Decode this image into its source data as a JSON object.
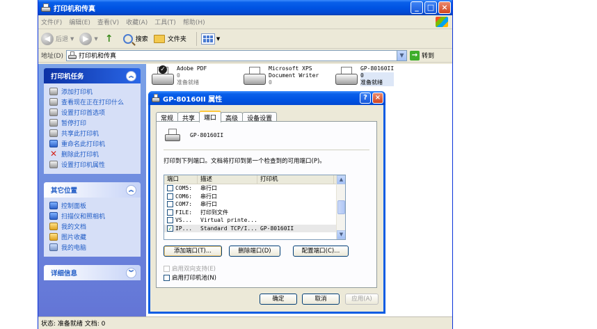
{
  "window": {
    "title": "打印机和传真",
    "menu": [
      "文件(F)",
      "编辑(E)",
      "查看(V)",
      "收藏(A)",
      "工具(T)",
      "帮助(H)"
    ],
    "toolbar": {
      "back": "后退",
      "search": "搜索",
      "folders": "文件夹"
    },
    "address": {
      "label": "地址(D)",
      "value": "打印机和传真",
      "go": "转到"
    },
    "status": "状态: 准备就绪 文档: 0"
  },
  "sidebar": {
    "printer_tasks": {
      "title": "打印机任务",
      "items": [
        "添加打印机",
        "查看现在正在打印什么",
        "设置打印首选项",
        "暂停打印",
        "共享此打印机",
        "重命名此打印机",
        "删除此打印机",
        "设置打印机属性"
      ]
    },
    "other_places": {
      "title": "其它位置",
      "items": [
        "控制面板",
        "扫描仪和照相机",
        "我的文档",
        "图片收藏",
        "我的电脑"
      ]
    },
    "details": {
      "title": "详细信息"
    }
  },
  "printers": [
    {
      "name": "Adobe PDF",
      "docs": "0",
      "status": "准备就绪"
    },
    {
      "name": "Microsoft XPS",
      "name2": "Document Writer",
      "docs": "0"
    },
    {
      "name": "GP-80160II",
      "docs": "0",
      "status": "准备就绪"
    }
  ],
  "dialog": {
    "title": "GP-80160II 属性",
    "tabs": [
      "常规",
      "共享",
      "端口",
      "高级",
      "设备设置"
    ],
    "active_tab": "端口",
    "device_name": "GP-80160II",
    "instruction": "打印到下列端口。文档将打印到第一个检查到的可用端口(P)。",
    "columns": [
      "端口",
      "描述",
      "打印机"
    ],
    "ports": [
      {
        "port": "COM5:",
        "desc": "串行口",
        "printer": "",
        "checked": false
      },
      {
        "port": "COM6:",
        "desc": "串行口",
        "printer": "",
        "checked": false
      },
      {
        "port": "COM7:",
        "desc": "串行口",
        "printer": "",
        "checked": false
      },
      {
        "port": "FILE:",
        "desc": "打印到文件",
        "printer": "",
        "checked": false
      },
      {
        "port": "VS...",
        "desc": "Virtual printe...",
        "printer": "",
        "checked": false
      },
      {
        "port": "IP...",
        "desc": "Standard TCP/I...",
        "printer": "GP-80160II",
        "checked": true
      }
    ],
    "add_port": "添加端口(T)...",
    "delete_port": "删除端口(D)",
    "configure_port": "配置端口(C)...",
    "bidirectional": "启用双向支持(E)",
    "pooling": "启用打印机池(N)",
    "ok": "确定",
    "cancel": "取消",
    "apply": "应用(A)"
  }
}
